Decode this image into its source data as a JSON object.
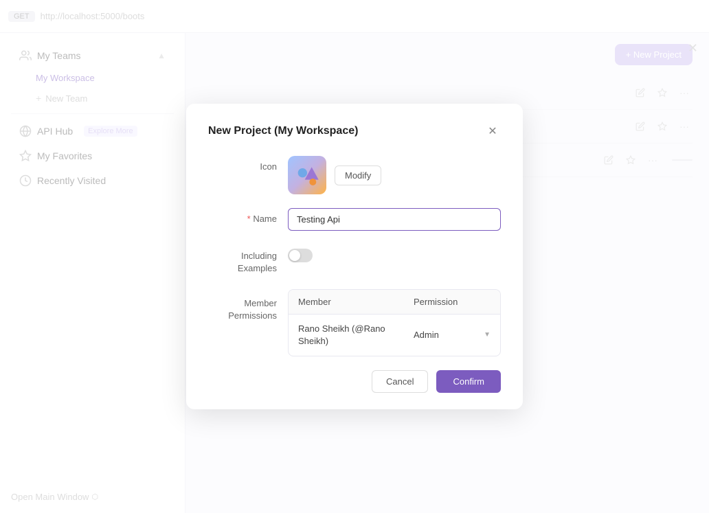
{
  "topbar": {
    "method_badge": "GET",
    "url": "http://localhost:5000/boots"
  },
  "sidebar": {
    "my_teams_label": "My Teams",
    "my_workspace_label": "My Workspace",
    "new_team_label": "New Team",
    "api_hub_label": "API Hub",
    "api_hub_sub": "Explore More",
    "my_favorites_label": "My Favorites",
    "recently_visited_label": "Recently Visited"
  },
  "main": {
    "new_project_btn": "+ New Project"
  },
  "bottom": {
    "open_main_window": "Open Main Window"
  },
  "modal": {
    "title": "New Project (My Workspace)",
    "icon_label": "Icon",
    "modify_label": "Modify",
    "name_label": "Name",
    "name_required": true,
    "name_value": "Testing Api",
    "including_examples_label": "Including\nExamples",
    "member_permissions_label": "Member\nPermissions",
    "table_col_member": "Member",
    "table_col_permission": "Permission",
    "member_name": "Rano Sheikh (@Rano Sheikh)",
    "member_permission": "Admin",
    "cancel_label": "Cancel",
    "confirm_label": "Confirm"
  }
}
